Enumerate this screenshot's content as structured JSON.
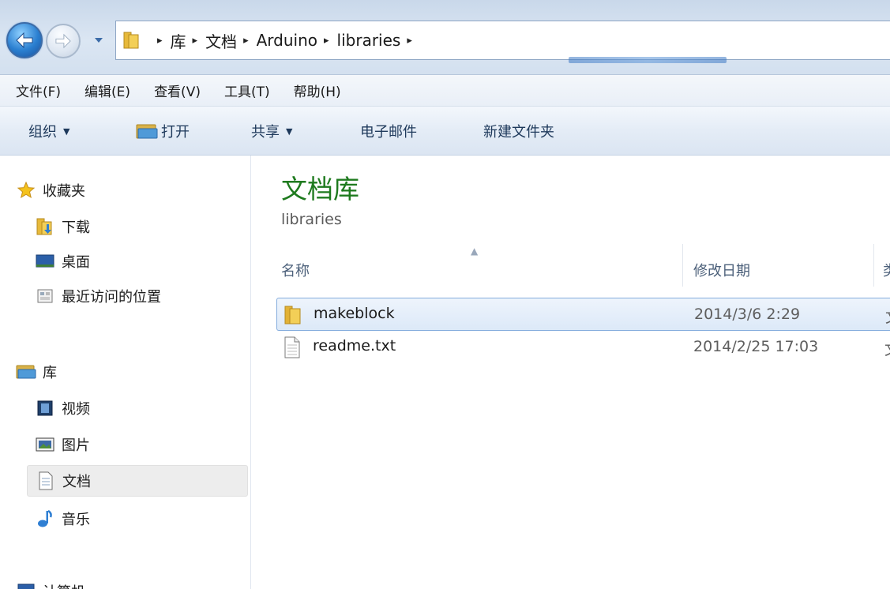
{
  "address": {
    "crumbs": [
      "库",
      "文档",
      "Arduino",
      "libraries"
    ],
    "crumb_separator": "▸"
  },
  "menu": [
    "文件(F)",
    "编辑(E)",
    "查看(V)",
    "工具(T)",
    "帮助(H)"
  ],
  "toolbar": {
    "organize": "组织",
    "open": "打开",
    "share": "共享",
    "email": "电子邮件",
    "new_folder": "新建文件夹"
  },
  "nav": {
    "favorites_header": "收藏夹",
    "favorites": [
      "下载",
      "桌面",
      "最近访问的位置"
    ],
    "libraries_header": "库",
    "libraries": [
      "视频",
      "图片",
      "文档",
      "音乐"
    ],
    "selected_library": "文档",
    "computer": "计算机"
  },
  "content": {
    "title": "文档库",
    "subtitle": "libraries",
    "columns": {
      "name": "名称",
      "modified": "修改日期",
      "type": "类"
    },
    "files": [
      {
        "name": "makeblock",
        "modified": "2014/3/6 2:29",
        "type": "文",
        "kind": "folder",
        "selected": true
      },
      {
        "name": "readme.txt",
        "modified": "2014/2/25 17:03",
        "type": "文",
        "kind": "text-file",
        "selected": false
      }
    ]
  },
  "colors": {
    "title_green": "#1e7a1e",
    "selection_border": "#84acdd",
    "toolbar_text": "#1e395b"
  }
}
